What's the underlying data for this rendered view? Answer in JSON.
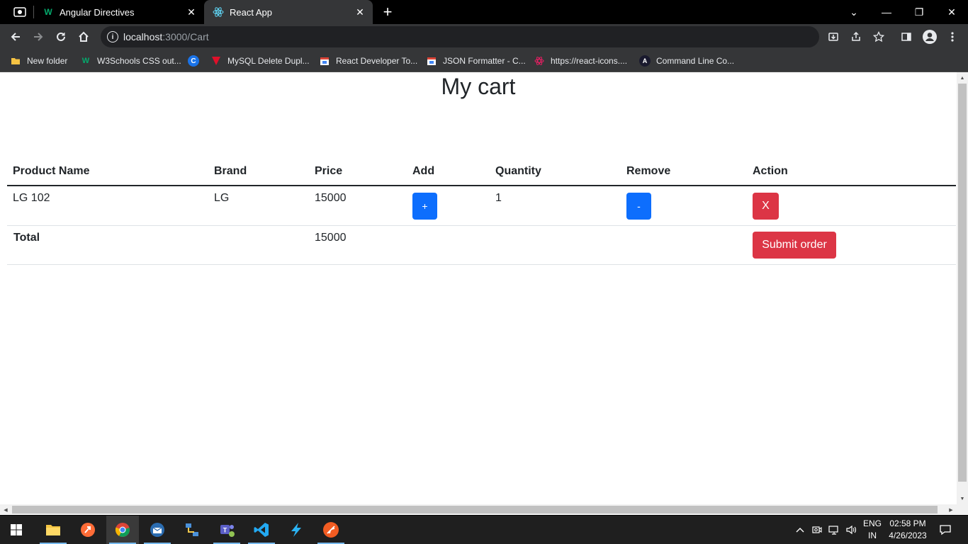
{
  "browser": {
    "tabs": [
      {
        "title": "Angular Directives",
        "close": "✕"
      },
      {
        "title": "React App",
        "close": "✕"
      }
    ],
    "new_tab": "+",
    "window_controls": {
      "chevron": "⌄",
      "minimize": "—",
      "restore": "❐",
      "close": "✕"
    },
    "url_host": "localhost",
    "url_path": ":3000/Cart",
    "bookmarks": [
      {
        "label": "New folder"
      },
      {
        "label": "W3Schools CSS out..."
      },
      {
        "label": ""
      },
      {
        "label": "MySQL Delete Dupl..."
      },
      {
        "label": "React Developer To..."
      },
      {
        "label": "JSON Formatter - C..."
      },
      {
        "label": "https://react-icons...."
      },
      {
        "label": "Command Line Co..."
      }
    ]
  },
  "page": {
    "title": "My cart",
    "table": {
      "headers": [
        "Product Name",
        "Brand",
        "Price",
        "Add",
        "Quantity",
        "Remove",
        "Action"
      ],
      "rows": [
        {
          "product_name": "LG 102",
          "brand": "LG",
          "price": "15000",
          "add_label": "+",
          "quantity": "1",
          "remove_label": "-",
          "action_label": "X"
        }
      ],
      "total": {
        "label": "Total",
        "price": "15000",
        "submit_label": "Submit order"
      }
    },
    "colors": {
      "primary": "#0d6efd",
      "danger": "#dc3545"
    }
  },
  "taskbar": {
    "language": "ENG",
    "region": "IN",
    "time": "02:58 PM",
    "date": "4/26/2023"
  }
}
